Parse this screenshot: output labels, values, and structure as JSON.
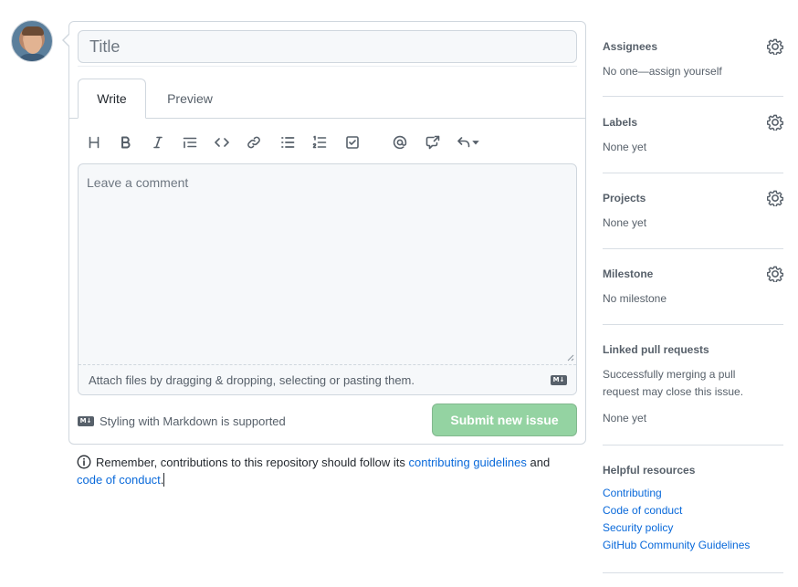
{
  "issue_form": {
    "title_placeholder": "Title",
    "tabs": [
      {
        "label": "Write",
        "active": true
      },
      {
        "label": "Preview",
        "active": false
      }
    ],
    "toolbar": [
      "heading-icon",
      "bold-icon",
      "italic-icon",
      "quote-icon",
      "code-icon",
      "link-icon",
      "unordered-list-icon",
      "ordered-list-icon",
      "task-list-icon",
      "mention-icon",
      "cross-reference-icon",
      "reply-icon"
    ],
    "comment_placeholder": "Leave a comment",
    "attach_text": "Attach files by dragging & dropping, selecting or pasting them.",
    "markdown_note": "Styling with Markdown is supported",
    "submit_label": "Submit new issue",
    "submit_color": "#94d3a2"
  },
  "contribution_note": {
    "prefix": "Remember, contributions to this repository should follow its ",
    "link1": "contributing guidelines",
    "middle": " and",
    "link2": "code of conduct",
    "suffix": "."
  },
  "sidebar": {
    "assignees": {
      "title": "Assignees",
      "value": "No one—assign yourself"
    },
    "labels": {
      "title": "Labels",
      "value": "None yet"
    },
    "projects": {
      "title": "Projects",
      "value": "None yet"
    },
    "milestone": {
      "title": "Milestone",
      "value": "No milestone"
    },
    "linked_prs": {
      "title": "Linked pull requests",
      "description": "Successfully merging a pull request may close this issue.",
      "value": "None yet"
    },
    "helpful_resources": {
      "title": "Helpful resources",
      "links": [
        "Contributing",
        "Code of conduct",
        "Security policy",
        "GitHub Community Guidelines"
      ]
    }
  },
  "colors": {
    "link": "#0969da",
    "muted": "#57606a",
    "border": "#d0d7de"
  }
}
